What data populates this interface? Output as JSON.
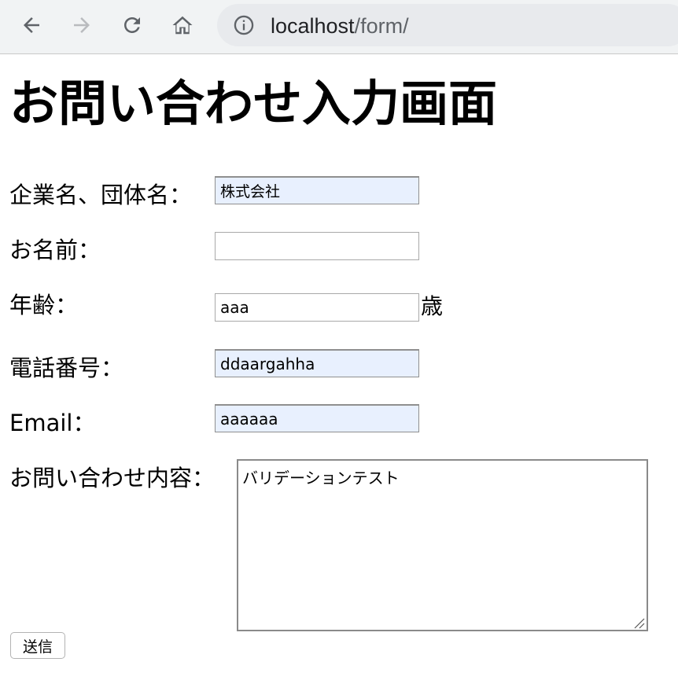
{
  "browser": {
    "url_host": "localhost",
    "url_path": "/form/",
    "icons": {
      "back": "arrow-left-icon",
      "forward": "arrow-right-icon",
      "reload": "reload-icon",
      "home": "home-icon",
      "site_info": "info-icon"
    },
    "forward_enabled": false
  },
  "page": {
    "title": "お問い合わせ入力画面"
  },
  "form": {
    "company_label": "企業名、団体名：",
    "company_value": "株式会社",
    "name_label": "お名前：",
    "name_value": "",
    "age_label": "年齢：",
    "age_value": "aaa",
    "age_unit": "歳",
    "phone_label": "電話番号：",
    "phone_value": "ddaargahha",
    "email_label": "Email：",
    "email_value": "aaaaaa",
    "inquiry_label": "お問い合わせ内容：",
    "inquiry_value": "バリデーションテスト",
    "submit_label": "送信"
  },
  "colors": {
    "toolbar_bg": "#f1f3f4",
    "omnibox_bg": "#e8eaed",
    "autofill_bg": "#e8f0fe"
  }
}
